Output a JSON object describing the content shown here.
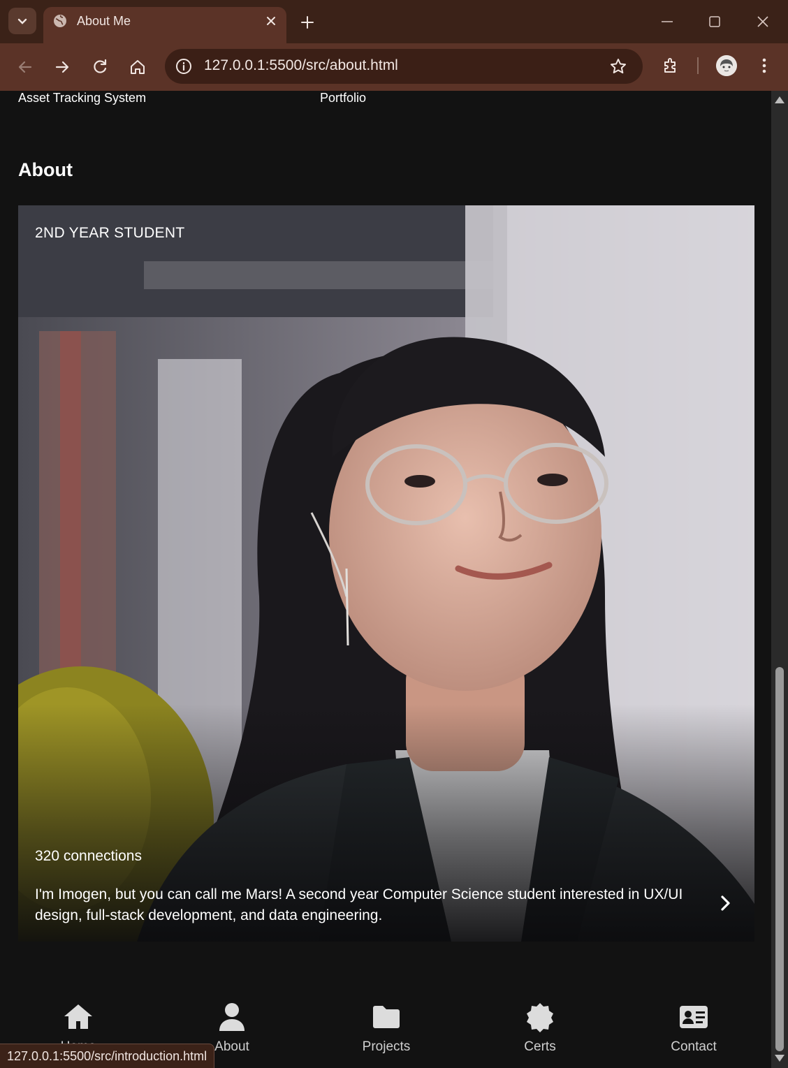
{
  "browser": {
    "tab_title": "About Me",
    "url": "127.0.0.1:5500/src/about.html",
    "status_url": "127.0.0.1:5500/src/introduction.html"
  },
  "page": {
    "project_labels": [
      "Asset Tracking System",
      "Portfolio"
    ],
    "section_title": "About",
    "card": {
      "eyebrow": "2ND YEAR STUDENT",
      "connections": "320 connections",
      "bio": "I'm Imogen, but you can call me Mars! A second year Computer Science student interested in UX/UI design, full-stack development, and data engineering."
    }
  },
  "bottom_nav": {
    "items": [
      {
        "label": "Home",
        "icon": "home-icon"
      },
      {
        "label": "About",
        "icon": "user-icon"
      },
      {
        "label": "Projects",
        "icon": "folder-icon"
      },
      {
        "label": "Certs",
        "icon": "badge-icon"
      },
      {
        "label": "Contact",
        "icon": "contact-card-icon"
      }
    ]
  },
  "colors": {
    "chrome_dark": "#3b2218",
    "chrome_toolbar": "#5b3327",
    "page_bg": "#121212"
  }
}
